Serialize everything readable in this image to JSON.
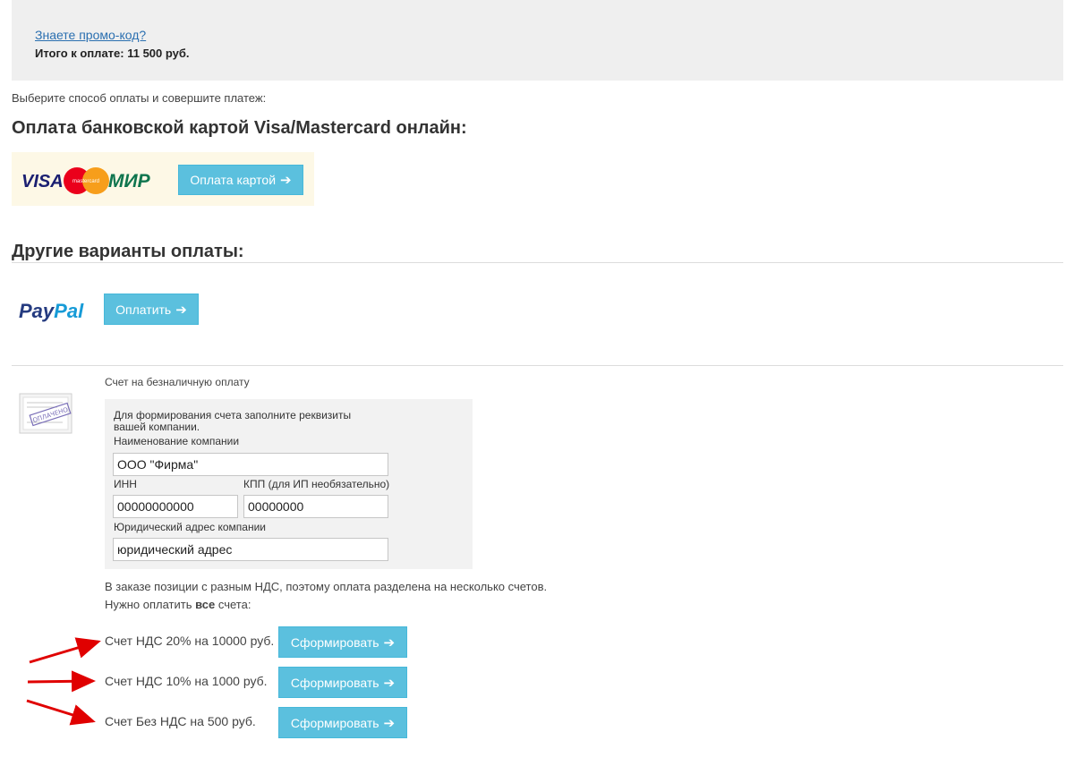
{
  "promo": {
    "link": "Знаете промо-код?",
    "total": "Итого к оплате: 11 500 руб."
  },
  "intro": "Выберите способ оплаты и совершите платеж:",
  "card_section": {
    "heading": "Оплата банковской картой Visa/Mastercard онлайн:",
    "logos": {
      "visa": "VISA",
      "mastercard": "mastercard",
      "mir": "МИР"
    },
    "button": "Оплата картой"
  },
  "other_section": {
    "heading": "Другие варианты оплаты:",
    "paypal": {
      "logo_pay": "Pay",
      "logo_pal": "Pal",
      "button": "Оплатить"
    }
  },
  "invoice": {
    "title": "Счет на безналичную оплату",
    "stamp": "ОПЛАЧЕНО",
    "form": {
      "instruction_line1": "Для формирования счета заполните реквизиты",
      "instruction_line2": "вашей компании.",
      "company_label": "Наименование компании",
      "company_value": "ООО \"Фирма\"",
      "inn_label": "ИНН",
      "inn_value": "00000000000",
      "kpp_label": "КПП (для ИП необязательно)",
      "kpp_value": "00000000",
      "address_label": "Юридический адрес компании",
      "address_value": "юридический адрес"
    },
    "notice_line1": "В заказе позиции с разным НДС, поэтому оплата разделена на несколько счетов.",
    "notice_line2_pre": "Нужно оплатить ",
    "notice_line2_bold": "все",
    "notice_line2_post": " счета:",
    "invoices": [
      {
        "label": "Счет НДС 20% на 10000 руб.",
        "button": "Сформировать"
      },
      {
        "label": "Счет НДС 10% на 1000 руб.",
        "button": "Сформировать"
      },
      {
        "label": "Счет Без НДС на 500 руб.",
        "button": "Сформировать"
      }
    ]
  },
  "colors": {
    "button": "#5bc0de",
    "arrow": "#e00000",
    "link": "#2a6fb0"
  }
}
